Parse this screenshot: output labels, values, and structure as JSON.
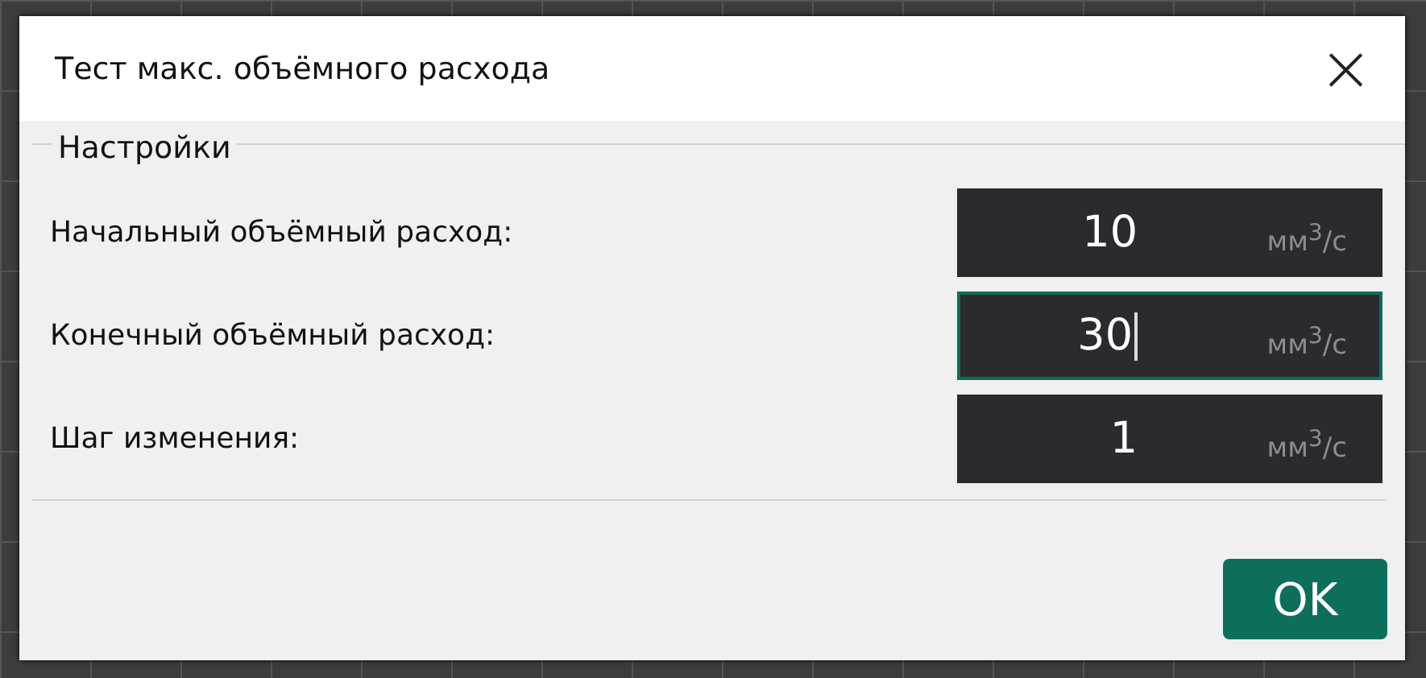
{
  "window": {
    "title": "Тест макс. объёмного расхода",
    "close": "×"
  },
  "group": {
    "title": "Настройки"
  },
  "fields": [
    {
      "label": "Начальный объёмный расход:",
      "value": "10",
      "unit": "мм$^{3}$/с",
      "focused": false
    },
    {
      "label": "Конечный объёмный расход:",
      "value": "30",
      "unit": "мм$^{3}$/с",
      "focused": true
    },
    {
      "label": "Шаг изменения:",
      "value": "1",
      "unit": "мм$^{3}$/с",
      "focused": false
    }
  ],
  "buttons": [
    {
      "label": "OK"
    }
  ]
}
